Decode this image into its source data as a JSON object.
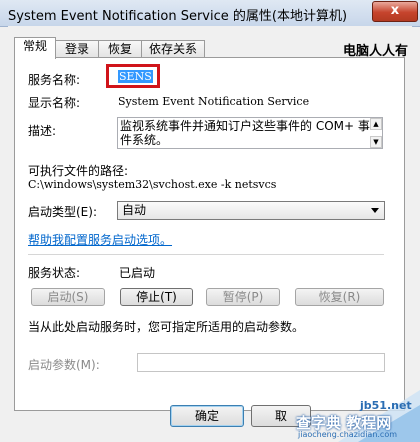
{
  "window": {
    "title": "System Event Notification Service 的属性(本地计算机)",
    "close_glyph": "x"
  },
  "tabs": [
    {
      "label": "常规"
    },
    {
      "label": "登录"
    },
    {
      "label": "恢复"
    },
    {
      "label": "依存关系"
    }
  ],
  "watermark_top": "电脑人人有",
  "general": {
    "service_name_label": "服务名称:",
    "service_name_value": "SENS",
    "display_name_label": "显示名称:",
    "display_name_value": "System Event Notification Service",
    "description_label": "描述:",
    "description_value": "监视系统事件并通知订户这些事件的 COM+ 事件系统。",
    "exe_path_label": "可执行文件的路径:",
    "exe_path_value": "C:\\windows\\system32\\svchost.exe -k netsvcs",
    "startup_type_label": "启动类型(E):",
    "startup_type_value": "自动",
    "help_link": "帮助我配置服务启动选项。",
    "status_label": "服务状态:",
    "status_value": "已启动",
    "buttons": {
      "start": "启动(S)",
      "stop": "停止(T)",
      "pause": "暂停(P)",
      "resume": "恢复(R)"
    },
    "hint": "当从此处启动服务时，您可指定所适用的启动参数。",
    "start_params_label": "启动参数(M):",
    "start_params_value": ""
  },
  "dialog_buttons": {
    "ok": "确定",
    "cancel": "取"
  },
  "watermark_bottom": {
    "site": "jb51.net",
    "text": "查字典 教程网",
    "url": "jiaocheng.chazidian.com"
  },
  "colors": {
    "selection": "#3399ff",
    "highlight_box": "#d0141a",
    "link": "#0066cc"
  }
}
